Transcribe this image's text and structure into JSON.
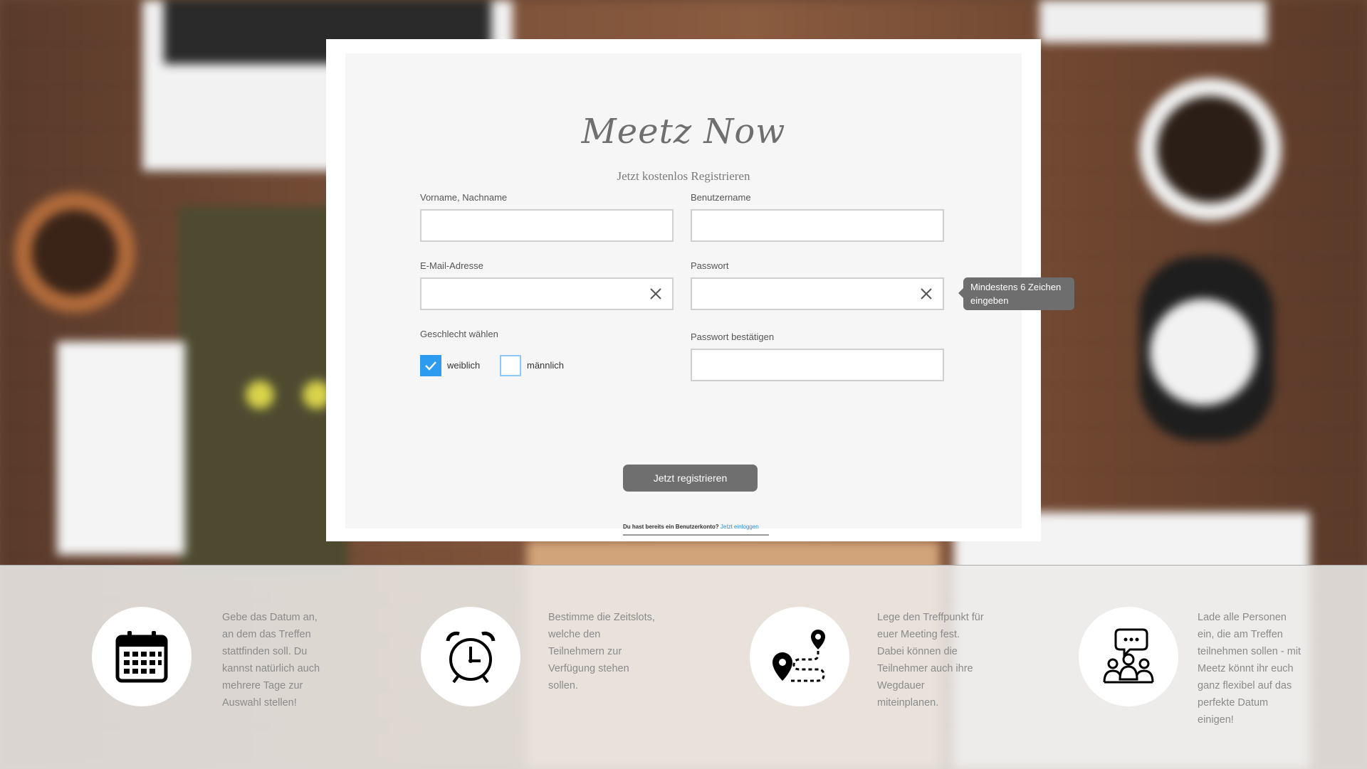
{
  "app": {
    "logo": "Meetz Now",
    "subtitle": "Jetzt kostenlos Registrieren"
  },
  "form": {
    "name": {
      "label": "Vorname, Nachname",
      "value": ""
    },
    "username": {
      "label": "Benutzername",
      "value": ""
    },
    "email": {
      "label": "E-Mail-Adresse",
      "value": ""
    },
    "password": {
      "label": "Passwort",
      "value": ""
    },
    "password_tooltip": "Mindestens 6 Zeichen eingeben",
    "gender": {
      "label": "Geschlecht wählen",
      "options": [
        {
          "label": "weiblich",
          "checked": true
        },
        {
          "label": "männlich",
          "checked": false
        }
      ]
    },
    "password_confirm": {
      "label": "Passwort bestätigen",
      "value": ""
    },
    "submit_label": "Jetzt registrieren",
    "login_prompt": "Du hast bereits ein Benutzerkonto?",
    "login_link": "Jetzt einloggen"
  },
  "features": [
    {
      "icon": "calendar-icon",
      "text": "Gebe das Datum an, an dem das Treffen stattfinden soll. Du kannst natürlich auch mehrere Tage zur Auswahl stellen!"
    },
    {
      "icon": "alarm-clock-icon",
      "text": "Bestimme die Zeitslots, welche den Teilnehmern zur Verfügung stehen sollen."
    },
    {
      "icon": "route-pin-icon",
      "text": "Lege den Treffpunkt für euer Meeting fest. Dabei können die Teilnehmer auch ihre Wegdauer miteinplanen."
    },
    {
      "icon": "group-chat-icon",
      "text": "Lade alle Personen ein, die am Treffen teilnehmen sollen - mit Meetz könnt ihr euch ganz flexibel auf das perfekte Datum einigen!"
    }
  ],
  "colors": {
    "accent": "#2d9cf0",
    "button": "#6f6f6f",
    "link": "#2d8fd8"
  }
}
